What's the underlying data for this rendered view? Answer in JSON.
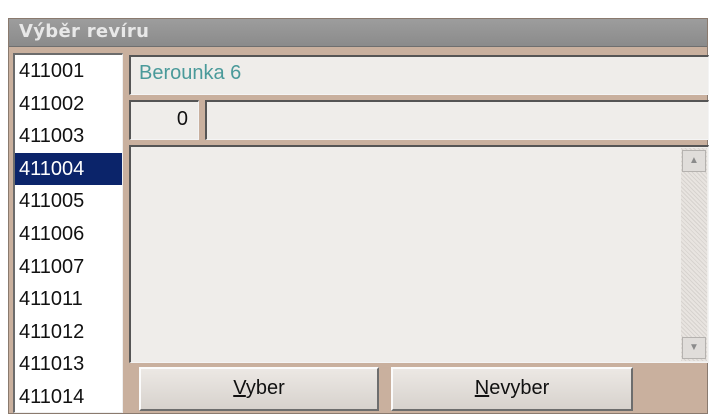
{
  "window": {
    "title": "Výběr revíru"
  },
  "list": {
    "items": [
      "411001",
      "411002",
      "411003",
      "411004",
      "411005",
      "411006",
      "411007",
      "411011",
      "411012",
      "411013",
      "411014"
    ],
    "selected": "411004"
  },
  "fields": {
    "name": "Berounka 6",
    "number": "0",
    "extra": ""
  },
  "memo": {
    "text": ""
  },
  "buttons": {
    "select_label": "Vyber",
    "deselect_label": "Nevyber"
  },
  "colors": {
    "selection": "#0b246a",
    "name_text": "#4a9a9a",
    "panel": "#c9b09e"
  }
}
